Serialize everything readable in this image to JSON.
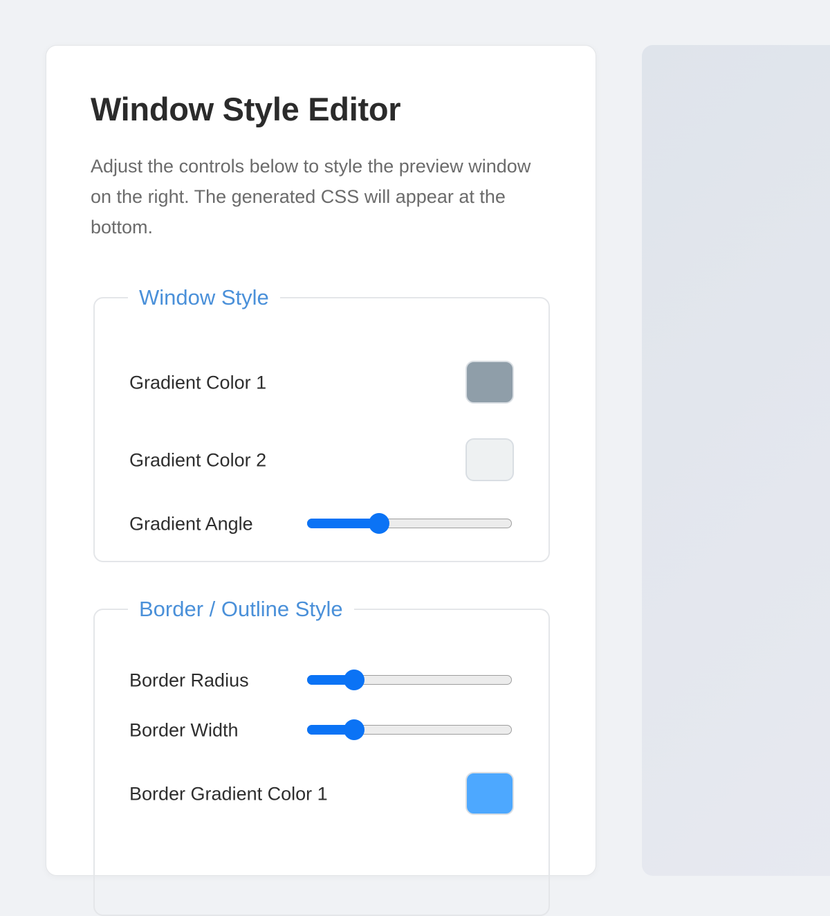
{
  "editor": {
    "title": "Window Style Editor",
    "description": "Adjust the controls below to style the preview window on the right. The generated CSS will appear at the bottom."
  },
  "window_style": {
    "legend": "Window Style",
    "gradient_color_1": {
      "label": "Gradient Color 1",
      "color": "#8f9ea9"
    },
    "gradient_color_2": {
      "label": "Gradient Color 2",
      "color": "#eef1f2"
    },
    "gradient_angle": {
      "label": "Gradient Angle",
      "fraction": 0.35
    }
  },
  "border_style": {
    "legend": "Border / Outline Style",
    "border_radius": {
      "label": "Border Radius",
      "fraction": 0.23
    },
    "border_width": {
      "label": "Border Width",
      "fraction": 0.23
    },
    "border_gradient_color_1": {
      "label": "Border Gradient Color 1",
      "color": "#4da8ff"
    }
  },
  "preview": {
    "gradient_start": "#dfe4eb",
    "gradient_end": "#e7e9f0"
  },
  "colors": {
    "accent": "#0b73f5",
    "legend": "#4a90d9",
    "page_background": "#f0f2f5"
  }
}
